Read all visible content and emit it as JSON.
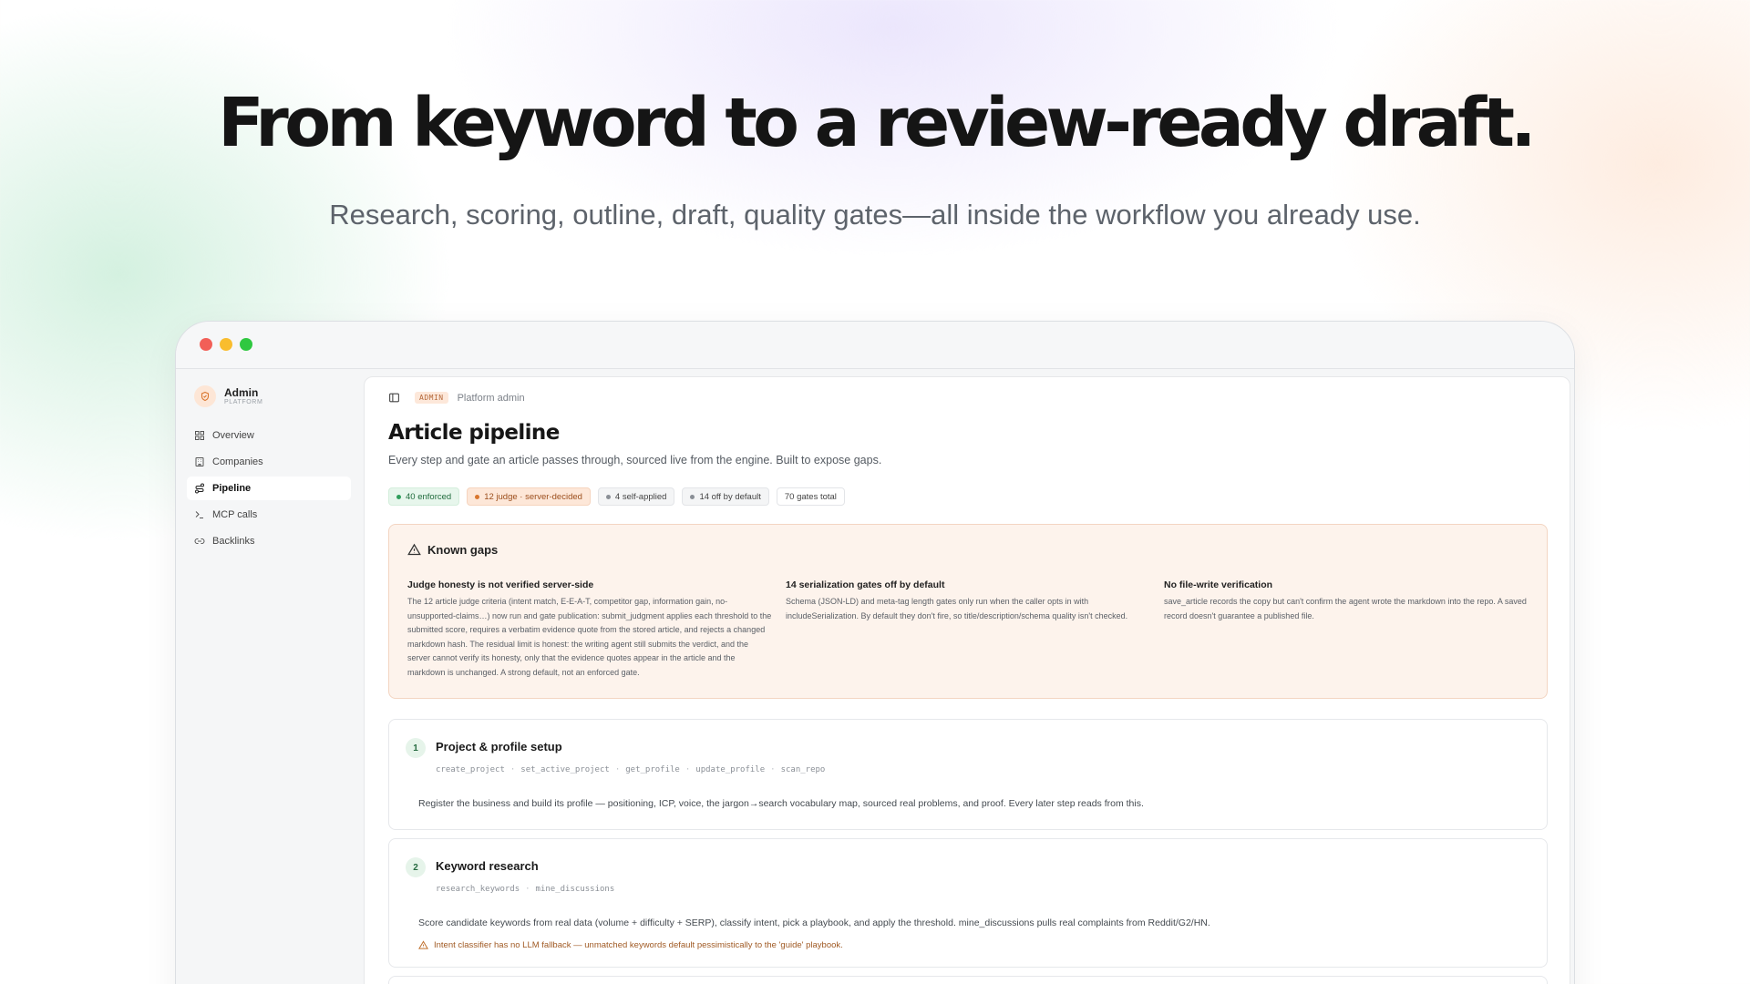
{
  "hero": {
    "title": "From keyword to a review-ready draft.",
    "subtitle": "Research, scoring, outline, draft, quality gates—all inside the workflow you already use."
  },
  "window_controls": [
    "close",
    "minimize",
    "maximize"
  ],
  "sidebar": {
    "brand_name": "Admin",
    "brand_tag": "PLATFORM",
    "brand_icon": "shield-icon",
    "items": [
      {
        "label": "Overview",
        "icon": "grid-icon",
        "active": false
      },
      {
        "label": "Companies",
        "icon": "building-icon",
        "active": false
      },
      {
        "label": "Pipeline",
        "icon": "route-icon",
        "active": true
      },
      {
        "label": "MCP calls",
        "icon": "terminal-icon",
        "active": false
      },
      {
        "label": "Backlinks",
        "icon": "link-icon",
        "active": false
      }
    ]
  },
  "header": {
    "toggle_icon": "sidebar-toggle-icon",
    "badge": "ADMIN",
    "breadcrumb": "Platform admin"
  },
  "page": {
    "title": "Article pipeline",
    "description": "Every step and gate an article passes through, sourced live from the engine. Built to expose gaps."
  },
  "chips": [
    {
      "label": "40 enforced",
      "style": "green",
      "dot": "#2f9e5c"
    },
    {
      "label": "12 judge · server-decided",
      "style": "orange",
      "dot": "#d9762e"
    },
    {
      "label": "4 self-applied",
      "style": "plain",
      "dot": "#8a8f96"
    },
    {
      "label": "14 off by default",
      "style": "plain",
      "dot": "#8a8f96"
    },
    {
      "label": "70 gates total",
      "style": "outline",
      "dot": ""
    }
  ],
  "known_gaps": {
    "heading": "Known gaps",
    "icon": "warning-icon",
    "items": [
      {
        "title": "Judge honesty is not verified server-side",
        "body": "The 12 article judge criteria (intent match, E-E-A-T, competitor gap, information gain, no-unsupported-claims…) now run and gate publication: submit_judgment applies each threshold to the submitted score, requires a verbatim evidence quote from the stored article, and rejects a changed markdown hash. The residual limit is honest: the writing agent still submits the verdict, and the server cannot verify its honesty, only that the evidence quotes appear in the article and the markdown is unchanged. A strong default, not an enforced gate."
      },
      {
        "title": "14 serialization gates off by default",
        "body": "Schema (JSON-LD) and meta-tag length gates only run when the caller opts in with includeSerialization. By default they don't fire, so title/description/schema quality isn't checked."
      },
      {
        "title": "No file-write verification",
        "body": "save_article records the copy but can't confirm the agent wrote the markdown into the repo. A saved record doesn't guarantee a published file."
      }
    ]
  },
  "steps": [
    {
      "number": "1",
      "title": "Project & profile setup",
      "tools": [
        "create_project",
        "set_active_project",
        "get_profile",
        "update_profile",
        "scan_repo"
      ],
      "description": "Register the business and build its profile — positioning, ICP, voice, the jargon→search vocabulary map, sourced real problems, and proof. Every later step reads from this.",
      "warning": ""
    },
    {
      "number": "2",
      "title": "Keyword research",
      "tools": [
        "research_keywords",
        "mine_discussions"
      ],
      "description": "Score candidate keywords from real data (volume + difficulty + SERP), classify intent, pick a playbook, and apply the threshold. mine_discussions pulls real complaints from Reddit/G2/HN.",
      "warning": "Intent classifier has no LLM fallback — unmatched keywords default pessimistically to the 'guide' playbook."
    }
  ]
}
